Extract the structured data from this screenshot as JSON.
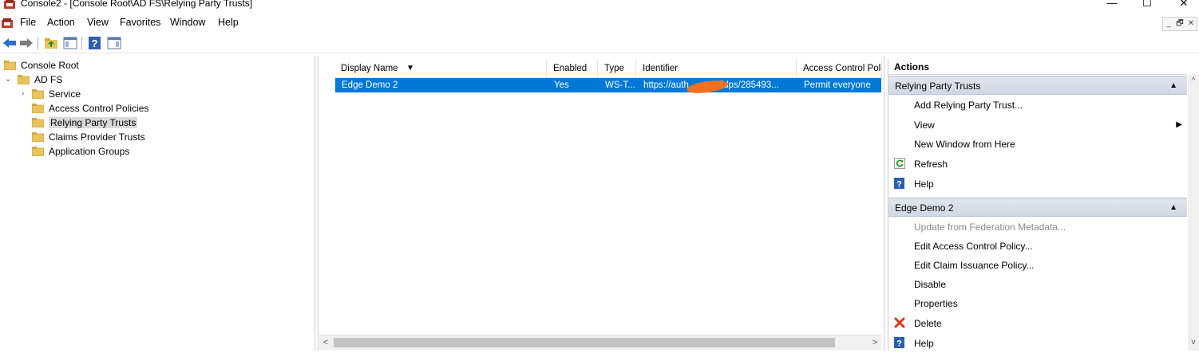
{
  "window": {
    "title": "Console2 - [Console Root\\AD FS\\Relying Party Trusts]",
    "minimize": "—",
    "maximize": "☐",
    "close": "✕"
  },
  "menu": [
    "File",
    "Action",
    "View",
    "Favorites",
    "Window",
    "Help"
  ],
  "mdi_controls": [
    "_",
    "🗗",
    "✕"
  ],
  "toolbar": {
    "icons": [
      "back-arrow-icon",
      "forward-arrow-icon",
      "up-folder-icon",
      "show-hide-tree-icon",
      "help-icon",
      "show-hide-action-pane-icon"
    ]
  },
  "tree": {
    "items": [
      {
        "label": "Console Root",
        "level": 0
      },
      {
        "label": "AD FS",
        "level": 1,
        "expanded": true
      },
      {
        "label": "Service",
        "level": 2,
        "expandable": true
      },
      {
        "label": "Access Control Policies",
        "level": 2
      },
      {
        "label": "Relying Party Trusts",
        "level": 2,
        "selected": true
      },
      {
        "label": "Claims Provider Trusts",
        "level": 2
      },
      {
        "label": "Application Groups",
        "level": 2
      }
    ]
  },
  "list": {
    "columns": [
      "Display Name",
      "Enabled",
      "Type",
      "Identifier",
      "Access Control Policy"
    ],
    "sort_indicator": "▼",
    "rows": [
      {
        "display_name": "Edge Demo 2",
        "enabled": "Yes",
        "type": "WS-T...",
        "identifier": "https://auth",
        "identifier_tail": "h/idps/285493...",
        "policy": "Permit everyone"
      }
    ],
    "scroll_left": "<",
    "scroll_right": ">"
  },
  "actions": {
    "title": "Actions",
    "groups": [
      {
        "label": "Relying Party Trusts",
        "items": [
          {
            "label": "Add Relying Party Trust...",
            "icon": "none"
          },
          {
            "label": "View",
            "icon": "none",
            "submenu": true
          },
          {
            "label": "New Window from Here",
            "icon": "none"
          },
          {
            "label": "Refresh",
            "icon": "refresh-icon"
          },
          {
            "label": "Help",
            "icon": "help-icon"
          }
        ]
      },
      {
        "label": "Edge Demo 2",
        "items": [
          {
            "label": "Update from Federation Metadata...",
            "icon": "none",
            "disabled": true
          },
          {
            "label": "Edit Access Control Policy...",
            "icon": "none"
          },
          {
            "label": "Edit Claim Issuance Policy...",
            "icon": "none"
          },
          {
            "label": "Disable",
            "icon": "none"
          },
          {
            "label": "Properties",
            "icon": "none"
          },
          {
            "label": "Delete",
            "icon": "delete-icon"
          },
          {
            "label": "Help",
            "icon": "help-icon"
          }
        ]
      }
    ]
  },
  "colors": {
    "selection": "#0078d7",
    "folder": "#e8c25a",
    "redaction": "#f37021"
  }
}
